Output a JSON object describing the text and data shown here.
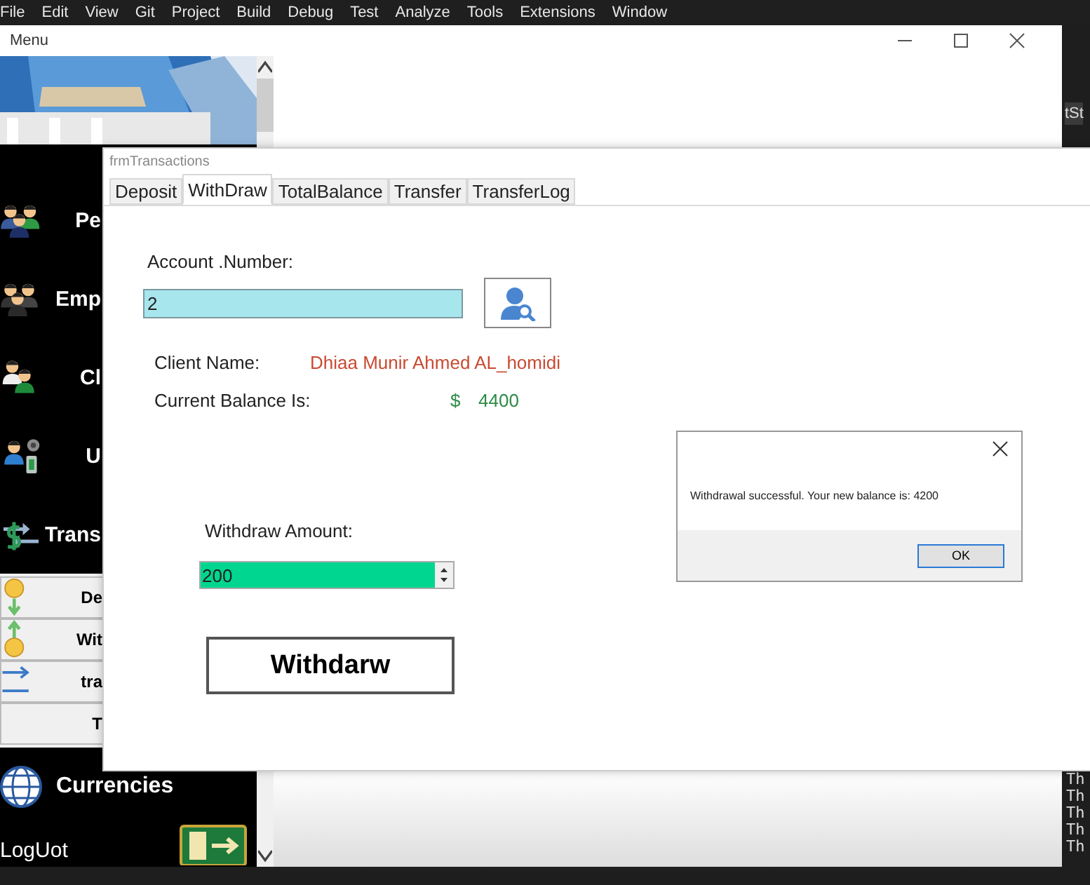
{
  "ide_menu": [
    "File",
    "Edit",
    "View",
    "Git",
    "Project",
    "Build",
    "Debug",
    "Test",
    "Analyze",
    "Tools",
    "Extensions",
    "Window"
  ],
  "ide_side": {
    "tab_text": "tSt",
    "output_lines": [
      "Th",
      "Th",
      "Th",
      "Th",
      "Th"
    ]
  },
  "menu_window": {
    "title": "Menu",
    "sidebar": [
      {
        "kind": "main",
        "label": "Pe"
      },
      {
        "kind": "main",
        "label": "Emp"
      },
      {
        "kind": "main",
        "label": "Cl"
      },
      {
        "kind": "main",
        "label": "U"
      },
      {
        "kind": "main",
        "label": "Trans"
      },
      {
        "kind": "sub",
        "label": "De"
      },
      {
        "kind": "sub",
        "label": "Wit"
      },
      {
        "kind": "sub",
        "label": "tra"
      },
      {
        "kind": "sub",
        "label": "T"
      },
      {
        "kind": "main",
        "label": "Currencies"
      },
      {
        "kind": "exit",
        "label": "LogUot"
      }
    ]
  },
  "transactions_window": {
    "title": "frmTransactions",
    "tabs": [
      {
        "label": "Deposit",
        "selected": false
      },
      {
        "label": "WithDraw",
        "selected": true
      },
      {
        "label": "TotalBalance",
        "selected": false
      },
      {
        "label": "Transfer",
        "selected": false
      },
      {
        "label": "TransferLog",
        "selected": false
      }
    ],
    "account_number": {
      "label": "Account .Number:",
      "value": "2"
    },
    "client_name": {
      "label": "Client Name:",
      "value": "Dhiaa Munir Ahmed AL_homidi"
    },
    "current_balance": {
      "label": "Current Balance Is:",
      "currency": "$",
      "value": "4400"
    },
    "withdraw_amount": {
      "label": "Withdraw Amount:",
      "value": "200"
    },
    "withdraw_button": "Withdarw"
  },
  "message_box": {
    "message": "Withdrawal successful. Your new balance is: 4200",
    "ok_button": "OK"
  }
}
